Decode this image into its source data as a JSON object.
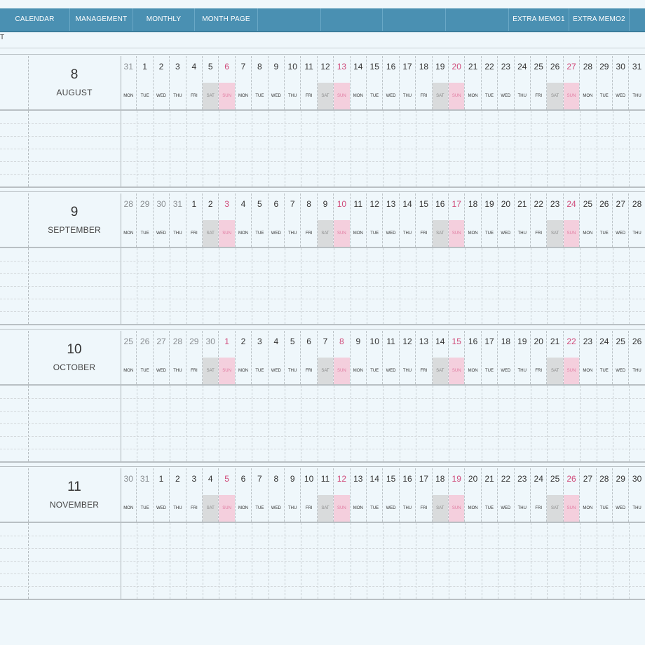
{
  "nav": {
    "tabs": [
      {
        "label": "CALENDAR"
      },
      {
        "label": "MANAGEMENT"
      },
      {
        "label": "MONTHLY"
      },
      {
        "label": "MONTH PAGE"
      },
      {
        "label": ""
      },
      {
        "label": ""
      },
      {
        "label": ""
      },
      {
        "label": ""
      },
      {
        "label": "EXTRA MEMO1"
      },
      {
        "label": "EXTRA MEMO2"
      },
      {
        "label": ""
      }
    ]
  },
  "stub_text": "T",
  "weekday_labels": [
    "MON",
    "TUE",
    "WED",
    "THU",
    "FRI",
    "SAT",
    "SUN"
  ],
  "months": [
    {
      "number": "8",
      "name": "AUGUST",
      "days": [
        "31",
        "1",
        "2",
        "3",
        "4",
        "5",
        "6",
        "7",
        "8",
        "9",
        "10",
        "11",
        "12",
        "13",
        "14",
        "15",
        "16",
        "17",
        "18",
        "19",
        "20",
        "21",
        "22",
        "23",
        "24",
        "25",
        "26",
        "27",
        "28",
        "29",
        "30",
        "31"
      ],
      "leading_gray": 1
    },
    {
      "number": "9",
      "name": "SEPTEMBER",
      "days": [
        "28",
        "29",
        "30",
        "31",
        "1",
        "2",
        "3",
        "4",
        "5",
        "6",
        "7",
        "8",
        "9",
        "10",
        "11",
        "12",
        "13",
        "14",
        "15",
        "16",
        "17",
        "18",
        "19",
        "20",
        "21",
        "22",
        "23",
        "24",
        "25",
        "26",
        "27",
        "28"
      ],
      "leading_gray": 4
    },
    {
      "number": "10",
      "name": "OCTOBER",
      "days": [
        "25",
        "26",
        "27",
        "28",
        "29",
        "30",
        "1",
        "2",
        "3",
        "4",
        "5",
        "6",
        "7",
        "8",
        "9",
        "10",
        "11",
        "12",
        "13",
        "14",
        "15",
        "16",
        "17",
        "18",
        "19",
        "20",
        "21",
        "22",
        "23",
        "24",
        "25",
        "26"
      ],
      "leading_gray": 6
    },
    {
      "number": "11",
      "name": "NOVEMBER",
      "days": [
        "30",
        "31",
        "1",
        "2",
        "3",
        "4",
        "5",
        "6",
        "7",
        "8",
        "9",
        "10",
        "11",
        "12",
        "13",
        "14",
        "15",
        "16",
        "17",
        "18",
        "19",
        "20",
        "21",
        "22",
        "23",
        "24",
        "25",
        "26",
        "27",
        "28",
        "29",
        "30"
      ],
      "leading_gray": 2
    }
  ]
}
